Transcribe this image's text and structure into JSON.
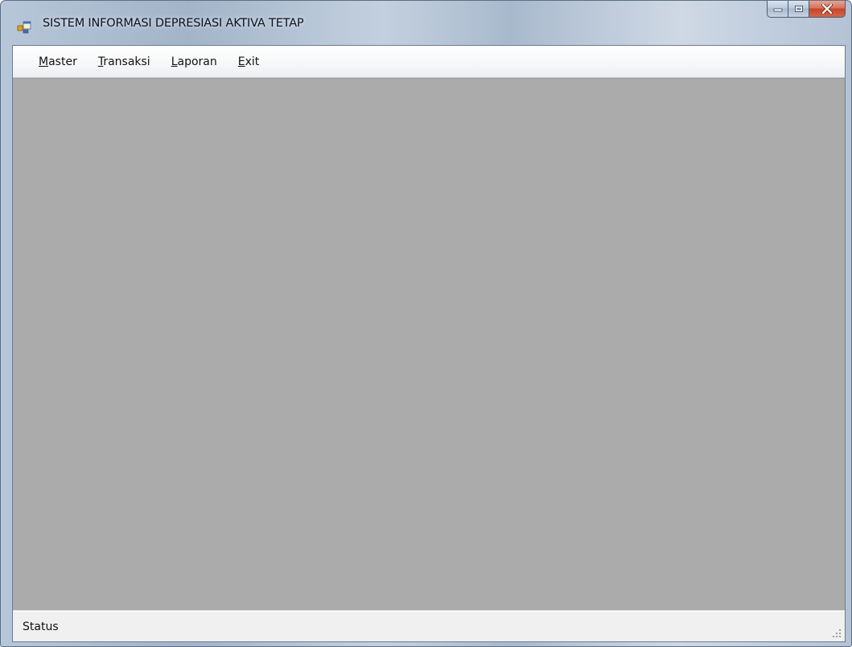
{
  "window": {
    "title": "SISTEM INFORMASI DEPRESIASI AKTIVA TETAP",
    "icon": "app-window-icon",
    "caption_buttons": [
      "minimize-icon",
      "maximize-icon",
      "close-icon"
    ]
  },
  "menubar": {
    "items": [
      {
        "mnemonic": "M",
        "rest": "aster"
      },
      {
        "mnemonic": "T",
        "rest": "ransaksi"
      },
      {
        "mnemonic": "L",
        "rest": "aporan"
      },
      {
        "mnemonic": "E",
        "rest": "xit"
      }
    ]
  },
  "statusbar": {
    "label": "Status"
  },
  "colors": {
    "mdi_background": "#ababab",
    "close_button": "#c6452c",
    "frame": "#b7c6d8"
  }
}
